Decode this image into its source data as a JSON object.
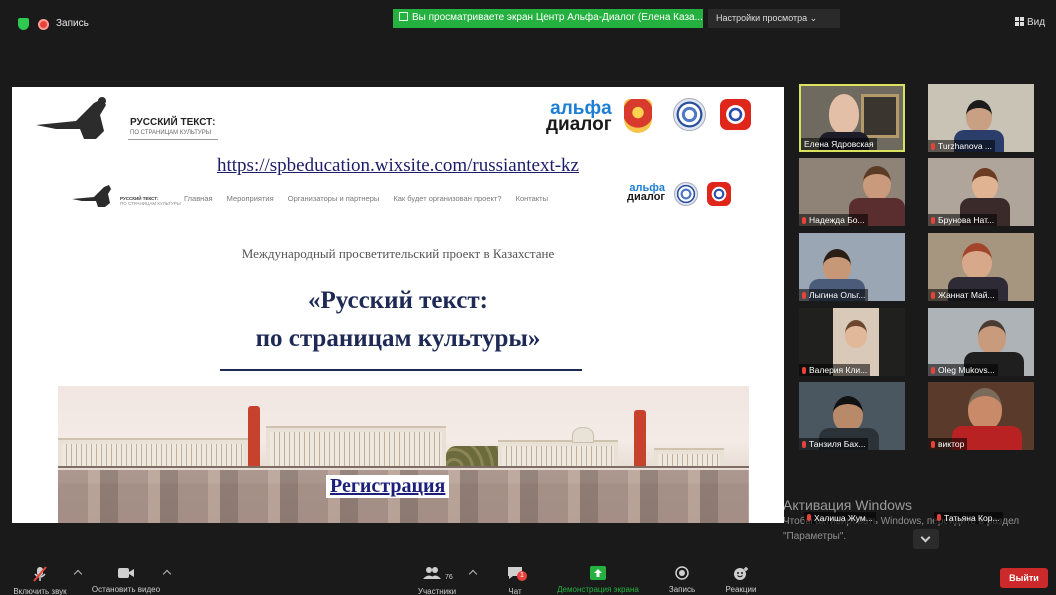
{
  "topbar": {
    "record_label": "Запись",
    "share_banner": "Вы просматриваете экран Центр Альфа-Диалог (Елена Каза...",
    "view_options": "Настройки просмотра ⌄",
    "view_button": "Вид"
  },
  "shared": {
    "site_title": "РУССКИЙ ТЕКСТ:",
    "site_subtitle": "ПО СТРАНИЦАМ КУЛЬТУРЫ",
    "logo_line1": "альфа",
    "logo_line2": "диалог",
    "url": "https://spbeducation.wixsite.com/russiantext-kz",
    "nav_brand": "РУССКИЙ ТЕКСТ:",
    "nav_brand_sub": "ПО СТРАНИЦАМ КУЛЬТУРЫ",
    "nav": [
      "Главная",
      "Мероприятия",
      "Организаторы и партнеры",
      "Как будет организован проект?",
      "Контакты"
    ],
    "intl_project": "Международный просветительский проект в Казахстане",
    "title_line1": "«Русский текст:",
    "title_line2": "по страницам культуры»",
    "register": "Регистрация"
  },
  "participants": [
    {
      "name": "Елена Ядровская",
      "muted": false,
      "active": true
    },
    {
      "name": "Turzhanova ...",
      "muted": true,
      "active": false
    },
    {
      "name": "Надежда Бо...",
      "muted": true,
      "active": false
    },
    {
      "name": "Брунова Нат...",
      "muted": true,
      "active": false
    },
    {
      "name": "Лыгина Ольг...",
      "muted": true,
      "active": false
    },
    {
      "name": "Жаннат Май...",
      "muted": true,
      "active": false
    },
    {
      "name": "Валерия Кли...",
      "muted": true,
      "active": false
    },
    {
      "name": "Oleg Mukovs...",
      "muted": true,
      "active": false
    },
    {
      "name": "Танзиля Бах...",
      "muted": true,
      "active": false
    },
    {
      "name": "виктор",
      "muted": true,
      "active": false
    }
  ],
  "strip": {
    "left_name": "Халиша Жум...",
    "right_name": "Татьяна Кор..."
  },
  "watermark": {
    "title": "Активация Windows",
    "text": "Чтобы активировать Windows, перейдите в раздел \"Параметры\"."
  },
  "toolbar": {
    "unmute": "Включить звук",
    "stop_video": "Остановить видео",
    "participants": "Участники",
    "participants_count": "76",
    "chat": "Чат",
    "chat_badge": "1",
    "share_screen": "Демонстрация экрана",
    "record": "Запись",
    "reactions": "Реакции",
    "leave": "Выйти"
  },
  "colors": {
    "share_green": "#25b13f",
    "leave_red": "#cc2a2a",
    "active_speaker": "#d8e25c",
    "title_navy": "#1e2a55"
  }
}
